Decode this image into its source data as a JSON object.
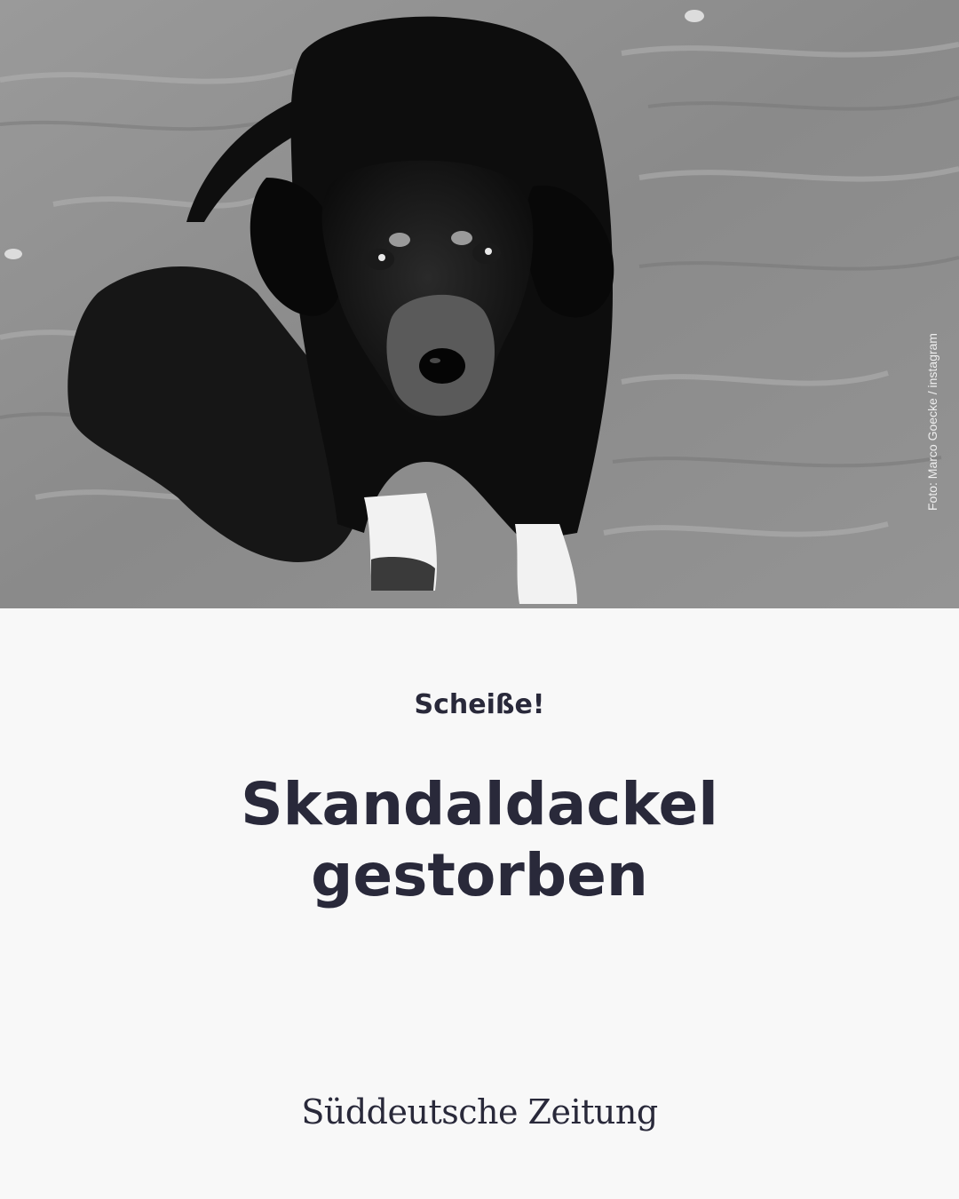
{
  "photo": {
    "subject": "black-and-white photo of a dachshund on sand",
    "credit": "Foto: Marco Goecke / instagram"
  },
  "article": {
    "kicker": "Scheiße!",
    "headline": "Skandaldackel gestorben"
  },
  "brand": {
    "logo_text": "Süddeutsche Zeitung"
  },
  "colors": {
    "text": "#29293a",
    "background": "#f8f8f8"
  }
}
